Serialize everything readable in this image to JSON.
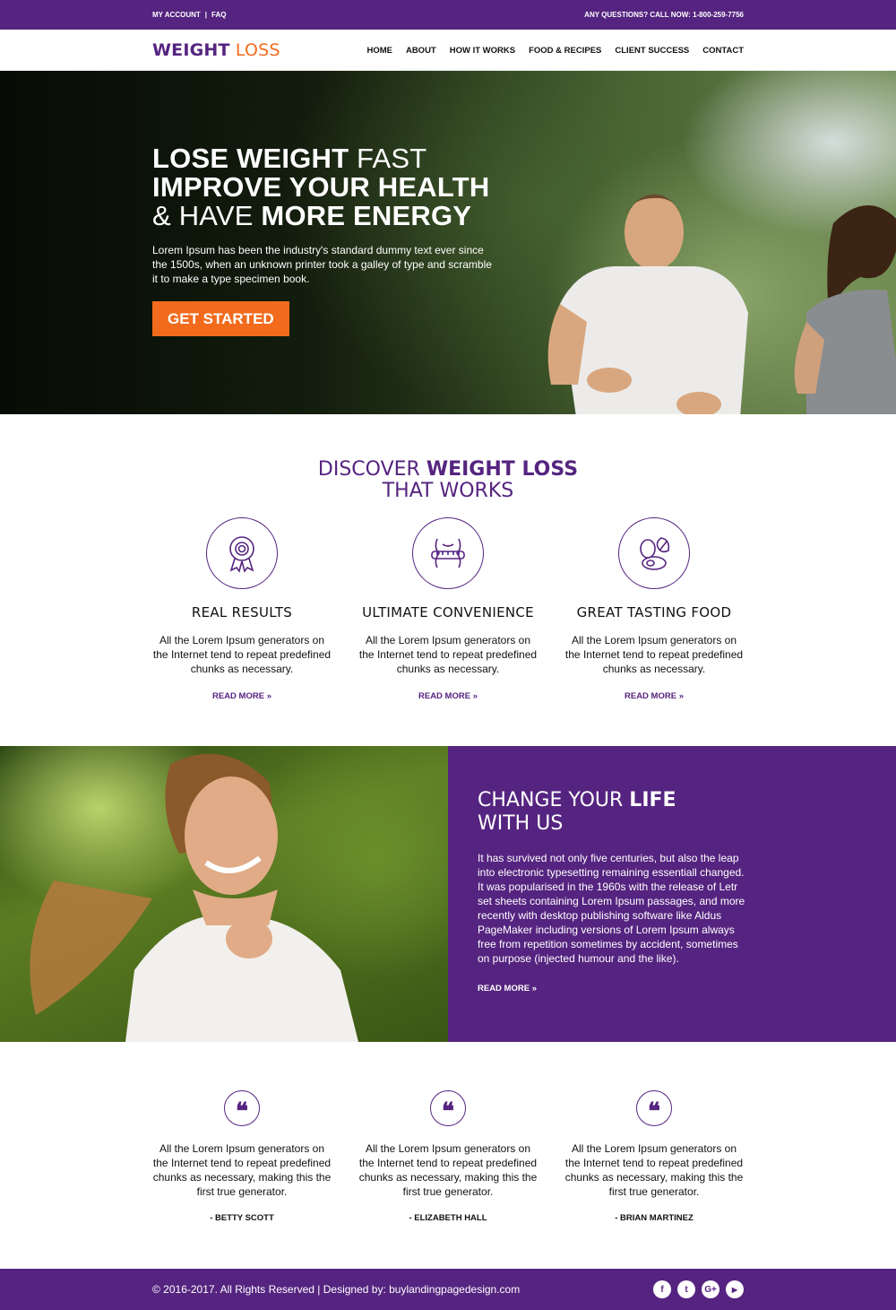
{
  "topbar": {
    "links": [
      "MY ACCOUNT",
      "FAQ"
    ],
    "separator": "|",
    "contact": "ANY QUESTIONS? CALL NOW: 1-800-259-7756"
  },
  "nav": {
    "logo_part1": "WEIGHT",
    "logo_part2": "LOSS",
    "menu": [
      "HOME",
      "ABOUT",
      "HOW IT WORKS",
      "FOOD & RECIPES",
      "CLIENT SUCCESS",
      "CONTACT"
    ]
  },
  "hero": {
    "line1_bold": "LOSE WEIGHT",
    "line1_light": " FAST",
    "line2_bold": "IMPROVE YOUR HEALTH",
    "line3_light": "& HAVE ",
    "line3_bold": "MORE ENERGY",
    "text": "Lorem Ipsum has been the industry's standard dummy text ever since the 1500s, when an unknown printer took a galley of type and scramble it to make a type specimen book.",
    "cta": "GET STARTED"
  },
  "discover": {
    "title_light": "DISCOVER ",
    "title_bold": "WEIGHT LOSS",
    "title_line2": "THAT WORKS",
    "features": [
      {
        "icon": "award-ribbon-icon",
        "title": "REAL RESULTS",
        "text": "All the Lorem Ipsum generators on the Internet tend to repeat predefined chunks as necessary.",
        "link": "READ MORE »"
      },
      {
        "icon": "measuring-tape-waist-icon",
        "title": "ULTIMATE CONVENIENCE",
        "text": "All the Lorem Ipsum generators on the Internet tend to repeat predefined chunks as necessary.",
        "link": "READ MORE »"
      },
      {
        "icon": "healthy-food-icon",
        "title": "GREAT TASTING FOOD",
        "text": "All the Lorem Ipsum generators on the Internet tend to repeat predefined chunks as necessary.",
        "link": "READ MORE »"
      }
    ]
  },
  "change": {
    "title_light": "CHANGE YOUR ",
    "title_bold": "LIFE",
    "title_line2": "WITH US",
    "text": "It has survived not only five centuries, but also the leap into electronic typesetting remaining essentiall changed. It was popularised in the 1960s with the release of Letr set sheets containing Lorem Ipsum passages, and more recently with desktop publishing software like Aldus PageMaker including versions of Lorem Ipsum always free from repetition sometimes by accident, sometimes on purpose (injected humour and the like).",
    "link": "READ MORE »"
  },
  "testimonials": [
    {
      "icon": "quote-icon",
      "glyph": "❝",
      "text": "All the Lorem Ipsum generators on the Internet tend to repeat predefined chunks as necessary, making this the first true generator.",
      "author": "- BETTY SCOTT"
    },
    {
      "icon": "quote-icon",
      "glyph": "❝",
      "text": "All the Lorem Ipsum generators on the Internet tend to repeat predefined chunks as necessary, making this the first true generator.",
      "author": "- ELIZABETH HALL"
    },
    {
      "icon": "quote-icon",
      "glyph": "❝",
      "text": "All the Lorem Ipsum generators on the Internet tend to repeat predefined chunks as necessary, making this the first true generator.",
      "author": "- BRIAN MARTINEZ"
    }
  ],
  "footer": {
    "copyright": "© 2016-2017. All Rights Reserved  |  Designed by: buylandingpagedesign.com",
    "socials": [
      {
        "icon": "facebook-icon",
        "glyph": "f"
      },
      {
        "icon": "twitter-icon",
        "glyph": "t"
      },
      {
        "icon": "google-plus-icon",
        "glyph": "G+"
      },
      {
        "icon": "youtube-icon",
        "glyph": "▶"
      }
    ]
  },
  "colors": {
    "brand_purple": "#552480",
    "accent_orange": "#f26b1d"
  }
}
